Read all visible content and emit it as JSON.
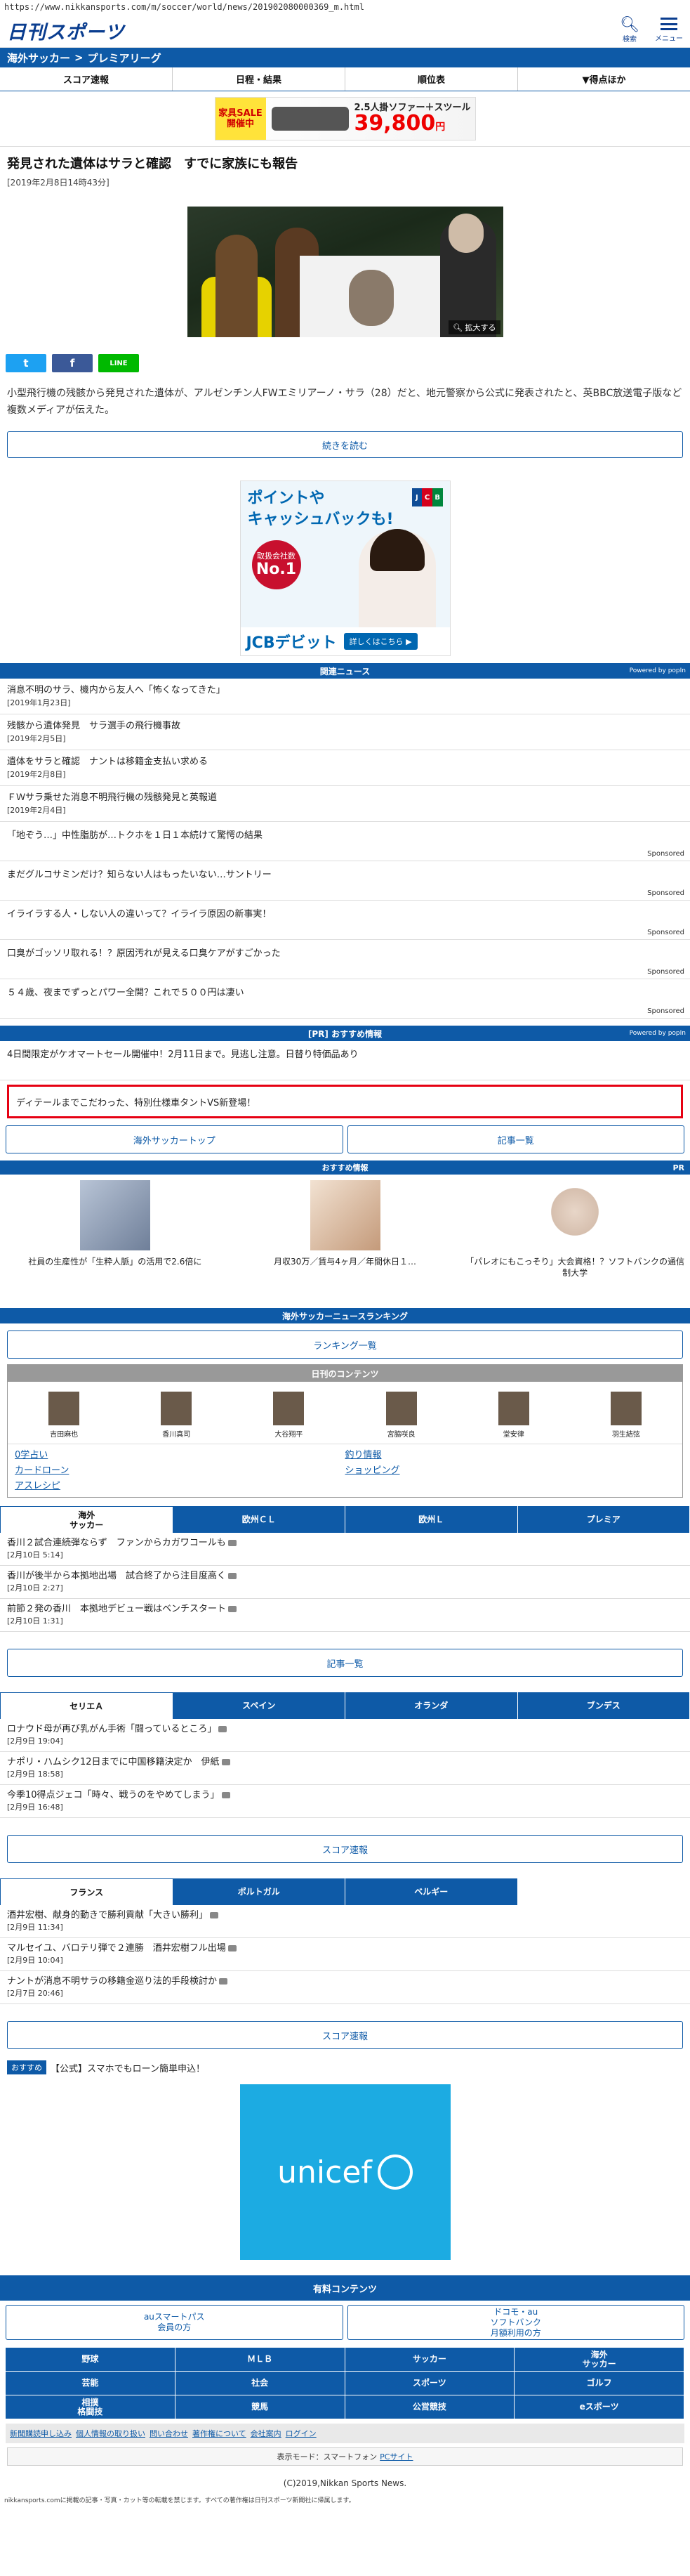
{
  "url": "https://www.nikkansports.com/m/soccer/world/news/201902080000369_m.html",
  "header": {
    "logo": "日刊スポーツ",
    "search_label": "検索",
    "menu_label": "メニュー"
  },
  "breadcrumb": {
    "parent": "海外サッカー",
    "sep": ">",
    "current": "プレミアリーグ"
  },
  "nav": [
    "スコア速報",
    "日程・結果",
    "順位表",
    "▼得点ほか"
  ],
  "top_ad": {
    "tag": "家具SALE",
    "tag2": "開催中",
    "line1": "2.5人掛ソファー＋スツール",
    "price": "39,800",
    "yen": "円"
  },
  "article": {
    "title": "発見された遺体はサラと確認　すでに家族にも報告",
    "date": "[2019年2月8日14時43分]",
    "photo_zoom": "拡大する",
    "lead": "小型飛行機の残骸から発見された遺体が、アルゼンチン人FWエミリアーノ・サラ（28）だと、地元警察から公式に発表されたと、英BBC放送電子版など複数メディアが伝えた。",
    "read_more": "続きを読む"
  },
  "share": {
    "twitter": "t",
    "facebook": "f",
    "line": "LINE"
  },
  "jcb_ad": {
    "headline1": "ポイントや",
    "headline2": "キャッシュバックも!",
    "badge_small": "取扱会社数",
    "badge_big": "No.1",
    "logo": [
      "J",
      "C",
      "B"
    ],
    "brand": "JCBデビット",
    "cta": "詳しくはこちら ▶"
  },
  "related": {
    "header": "関連ニュース",
    "powered": "Powered by popIn",
    "items": [
      {
        "title": "消息不明のサラ、機内から友人へ「怖くなってきた」",
        "date": "[2019年1月23日]"
      },
      {
        "title": "残骸から遺体発見　サラ選手の飛行機事故",
        "date": "[2019年2月5日]"
      },
      {
        "title": "遺体をサラと確認　ナントは移籍金支払い求める",
        "date": "[2019年2月8日]"
      },
      {
        "title": "ＦＷサラ乗せた消息不明飛行機の残骸発見と英報道",
        "date": "[2019年2月4日]"
      }
    ],
    "sponsored": [
      "「地ぞう…」中性脂肪が…トクホを１日１本続けて驚愕の結果",
      "まだグルコサミンだけ？知らない人はもったいない…サントリー",
      "イライラする人・しない人の違いって？イライラ原因の新事実！",
      "口臭がゴッソリ取れる！？原因汚れが見える口臭ケアがすごかった",
      "５４歳、夜までずっとパワー全開？これで５００円は凄い"
    ],
    "sponsored_label": "Sponsored"
  },
  "pr": {
    "header": "[PR] おすすめ情報",
    "powered": "Powered by popIn",
    "line": "4日間限定がケオマートセール開催中！2月11日まで。見逃し注意。日替り特価品あり",
    "red_box": "ディテールまでこだわった、特別仕様車タントVS新登場！"
  },
  "buttons_row1": [
    "海外サッカートップ",
    "記事一覧"
  ],
  "recommend": {
    "header": "おすすめ情報",
    "pr": "PR",
    "items": [
      "社員の生産性が「生粋人脈」の活用で2.6倍に",
      "月収30万／賃与4ヶ月／年間休日１…",
      "「パレオにもこっそり」大会資格！？ソフトバンクの通信制大学"
    ]
  },
  "ranking": {
    "header": "海外サッカーニュースランキング",
    "button": "ランキング一覧"
  },
  "daily": {
    "header": "日刊のコンテンツ",
    "celebs": [
      "吉田麻也",
      "香川真司",
      "大谷翔平",
      "宮脇咲良",
      "堂安律",
      "羽生結弦"
    ],
    "links": [
      "0学占い",
      "釣り情報",
      "カードローン",
      "ショッピング",
      "アスレシピ"
    ]
  },
  "tabs1": {
    "items": [
      "海外\nサッカー",
      "欧州ＣＬ",
      "欧州Ｌ",
      "プレミア"
    ],
    "active": 0
  },
  "news1": [
    {
      "title": "香川２試合連続弾ならず　ファンからカガワコールも",
      "date": "[2月10日 5:14]"
    },
    {
      "title": "香川が後半から本拠地出場　試合終了から注目度高く",
      "date": "[2月10日 2:27]"
    },
    {
      "title": "前節２発の香川　本拠地デビュー戦はベンチスタート",
      "date": "[2月10日 1:31]"
    }
  ],
  "news1_button": "記事一覧",
  "tabs2": {
    "items": [
      "セリエＡ",
      "スペイン",
      "オランダ",
      "ブンデス"
    ],
    "active": 0
  },
  "news2": [
    {
      "title": "ロナウド母が再び乳がん手術「闘っているところ」",
      "date": "[2月9日 19:04]"
    },
    {
      "title": "ナポリ・ハムシク12日までに中国移籍決定か　伊紙",
      "date": "[2月9日 18:58]"
    },
    {
      "title": "今季10得点ジェコ「時々、戦うのをやめてしまう」",
      "date": "[2月9日 16:48]"
    }
  ],
  "news2_button": "スコア速報",
  "tabs3": {
    "items": [
      "フランス",
      "ポルトガル",
      "ベルギー"
    ],
    "active": 0
  },
  "news3": [
    {
      "title": "酒井宏樹、献身的動きで勝利貢献「大きい勝利」",
      "date": "[2月9日 11:34]"
    },
    {
      "title": "マルセイユ、バロテリ弾で２連勝　酒井宏樹フル出場",
      "date": "[2月9日 10:04]"
    },
    {
      "title": "ナントが消息不明サラの移籍金巡り法的手段検討か",
      "date": "[2月7日 20:46]"
    }
  ],
  "news3_button": "スコア速報",
  "osusume": {
    "tag": "おすすめ",
    "text": "【公式】スマホでもローン簡単申込！"
  },
  "unicef": "unicef",
  "paid": {
    "header": "有料コンテンツ",
    "buttons": [
      "auスマートパス\n会員の方",
      "ドコモ・au\nソフトバンク\n月額利用の方"
    ]
  },
  "grid": [
    "野球",
    "ＭＬＢ",
    "サッカー",
    "海外\nサッカー",
    "芸能",
    "社会",
    "スポーツ",
    "ゴルフ",
    "相撲\n格闘技",
    "競馬",
    "公営競技",
    "eスポーツ"
  ],
  "footer_links": [
    "新聞購読申し込み",
    "個人情報の取り扱い",
    "問い合わせ",
    "著作権について",
    "会社案内",
    "ログイン"
  ],
  "mode": {
    "label": "表示モード：スマートフォン",
    "link": "PCサイト"
  },
  "copyright": "(C)2019,Nikkan Sports News.",
  "notice": "nikkansports.comに掲載の記事・写真・カット等の転載を禁じます。すべての著作権は日刊スポーツ新聞社に帰属します。"
}
